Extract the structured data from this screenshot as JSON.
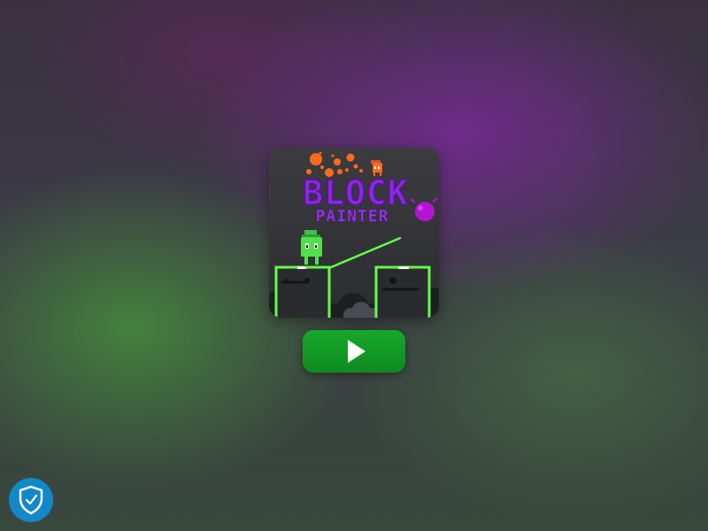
{
  "game": {
    "title_line1": "BLOCK",
    "title_line2": "PAINTER"
  },
  "play_button": {
    "icon": "play-icon",
    "color": "#13a02a"
  },
  "security_badge": {
    "icon": "shield-check-icon",
    "color": "#1288c9"
  },
  "colors": {
    "title_purple": "#8a2bd6",
    "neon_green": "#62ff4a",
    "paint_orange": "#ff6a1a",
    "paint_magenta": "#b414d8"
  }
}
